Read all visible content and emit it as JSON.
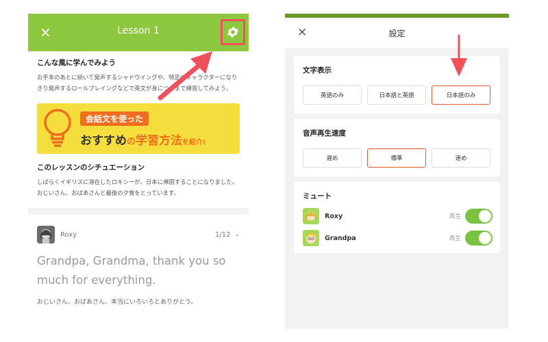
{
  "left": {
    "header": {
      "close_icon": "×",
      "title": "Lesson 1",
      "settings_icon": "gear-icon"
    },
    "section1": {
      "title": "こんな風に学んでみよう",
      "text": "お手本のあとに続いて発声するシャドウイングや、特定のキャラクターになりきり発声するロールプレイングなどで英文が身につくまで練習してみよう。"
    },
    "banner": {
      "tag": "会話文を使った",
      "headline_a": "おすすめ",
      "headline_b": "の",
      "headline_c": "学習方法",
      "headline_d": "を紹介!"
    },
    "section2": {
      "title": "このレッスンのシチュエーション",
      "text": "しばらくイギリスに滞在したロキシーが、日本に帰国することになりました。おじいさん、おばあさんと最後の夕食をとっています。"
    },
    "dialog": {
      "speaker": "Roxy",
      "page": "1/12",
      "english": "Grandpa, Grandma, thank you so much for everything.",
      "japanese": "おじいさん、おばあさん、本当にいろいろとありがとう。"
    }
  },
  "right": {
    "header": {
      "close_icon": "×",
      "title": "設定"
    },
    "text_display": {
      "title": "文字表示",
      "options": [
        "英語のみ",
        "日本語と英語",
        "日本語のみ"
      ],
      "selected": "日本語のみ"
    },
    "speed": {
      "title": "音声再生速度",
      "options": [
        "遅め",
        "標準",
        "速め"
      ],
      "selected": "標準"
    },
    "mute": {
      "title": "ミュート",
      "items": [
        {
          "name": "Roxy",
          "state_label": "再生",
          "on": true
        },
        {
          "name": "Grandpa",
          "state_label": "再生",
          "on": true
        }
      ]
    }
  },
  "colors": {
    "accent_green": "#8dc63f",
    "highlight_red": "#f0505b",
    "selected_border": "#e2572f",
    "toggle_on": "#7cc242"
  }
}
